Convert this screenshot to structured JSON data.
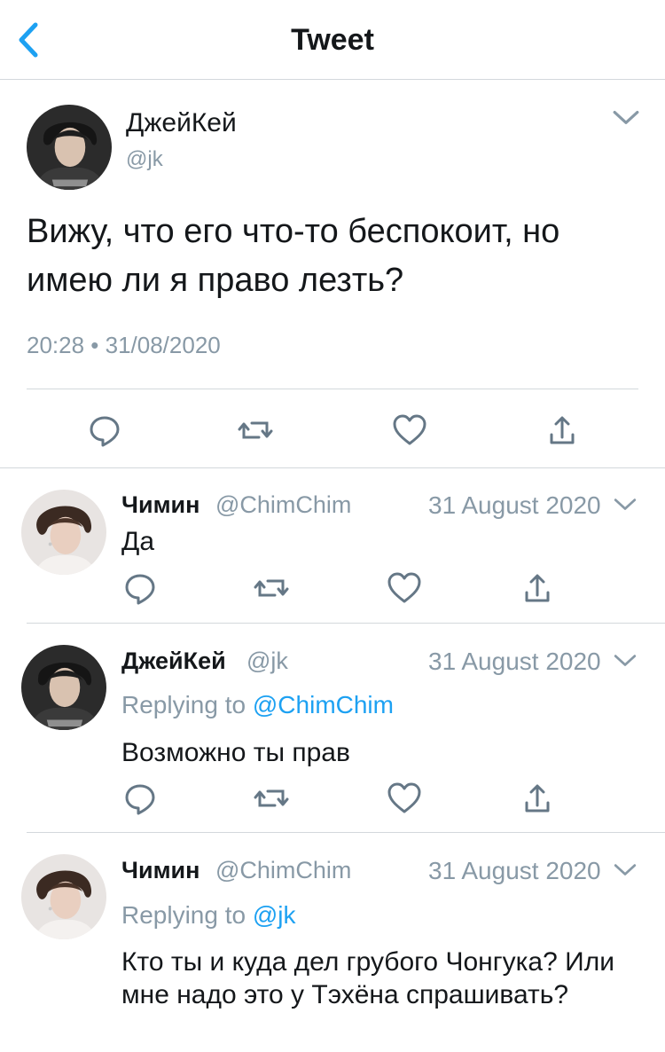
{
  "header": {
    "title": "Tweet",
    "back_icon": "chevron-left-icon",
    "accent": "#1da1f2"
  },
  "main_tweet": {
    "name": "ДжейКей",
    "handle": "@jk",
    "text": "Вижу, что его что-то беспокоит, но имею ли я право лезть?",
    "timestamp": "20:28 • 31/08/2020",
    "actions": [
      "reply-icon",
      "retweet-icon",
      "like-icon",
      "share-icon"
    ]
  },
  "replies": [
    {
      "name": "Чимин",
      "handle": "@ChimChim",
      "date": "31 August 2020",
      "replying_to_label": "",
      "replying_to": "",
      "text": "Да"
    },
    {
      "name": "ДжейКей",
      "handle": "@jk",
      "date": "31 August 2020",
      "replying_to_label": "Replying to",
      "replying_to": "@ChimChim",
      "text": "Возможно ты прав"
    },
    {
      "name": "Чимин",
      "handle": "@ChimChim",
      "date": "31 August 2020",
      "replying_to_label": "Replying to",
      "replying_to": "@jk",
      "text": "Кто ты и куда дел грубого Чонгука? Или мне надо это у Тэхёна спрашивать?"
    }
  ],
  "colors": {
    "text": "#14171a",
    "secondary": "#8899a6",
    "divider": "#d3d8dc",
    "link": "#1da1f2"
  }
}
